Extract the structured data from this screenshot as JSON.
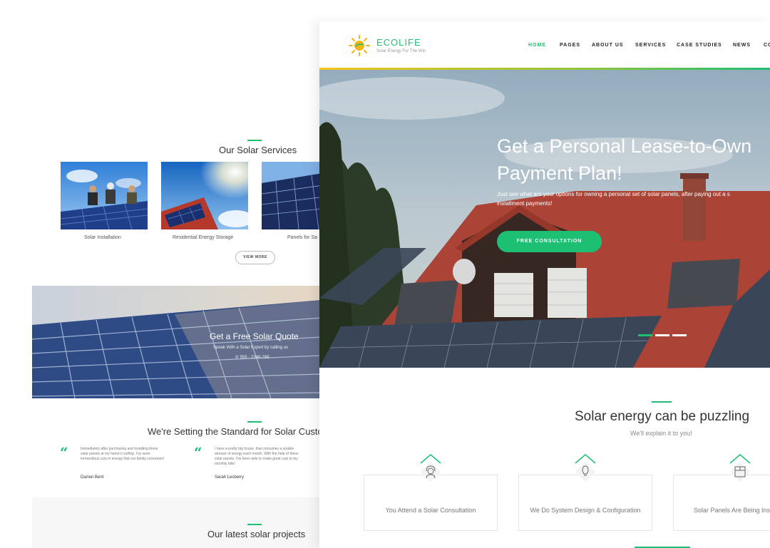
{
  "back_page": {
    "services": {
      "title": "Our Solar Services",
      "items": [
        {
          "caption": "Solar Installation"
        },
        {
          "caption": "Residential Energy Storage"
        },
        {
          "caption": "Panels for Sa"
        }
      ],
      "view_more_label": "VIEW MORE"
    },
    "quote_band": {
      "title": "Get a Free Solar Quote",
      "subtitle": "Speak With a Solar Expert by calling us",
      "phone": "555 - 2346-789"
    },
    "testimonials": {
      "title": "We're Setting the Standard for Solar Custon",
      "items": [
        {
          "text": "Immediately after purchasing and installing these solar panels at my home's rooftop, I've seen tremendous cuts in energy that our family consumes!",
          "name": "Darren Bent"
        },
        {
          "text": "I have a pretty big house, that consumes a sizable amount of energy each month. With the help of these solar panels, I've been able to make great cuts to my monthly bills!",
          "name": "Sarah Lesberry"
        }
      ]
    },
    "projects": {
      "title": "Our latest solar projects"
    }
  },
  "front_page": {
    "logo": {
      "name_part1": "ECO",
      "name_part2": "LIFE",
      "tagline": "Solar Energy For The Win"
    },
    "nav": [
      "HOME",
      "PAGES",
      "ABOUT US",
      "SERVICES",
      "CASE STUDIES",
      "NEWS",
      "CO"
    ],
    "hero": {
      "title_line1": "Get a Personal Lease-to-Own",
      "title_line2": "Payment Plan!",
      "text_line1": "Just see what are your options for owning a personal set of solar panels, after paying out a s",
      "text_line2": "installment payments!",
      "cta_label": "FREE CONSULTATION",
      "slides_total": 3,
      "active_slide": 1
    },
    "intro": {
      "title": "Solar energy can be puzzling",
      "subtitle": "We'll explain it to you!"
    },
    "features": [
      {
        "label": "You Attend a Solar Consultation",
        "icon": "headset-icon"
      },
      {
        "label": "We Do System Design & Configuration",
        "icon": "lightbulb-icon"
      },
      {
        "label": "Solar Panels Are Being Inst",
        "icon": "box-icon"
      }
    ]
  },
  "colors": {
    "accent": "#1dbf73",
    "brand_sun": "#f5b614",
    "text_dark": "#222222",
    "text_muted": "#777777"
  }
}
